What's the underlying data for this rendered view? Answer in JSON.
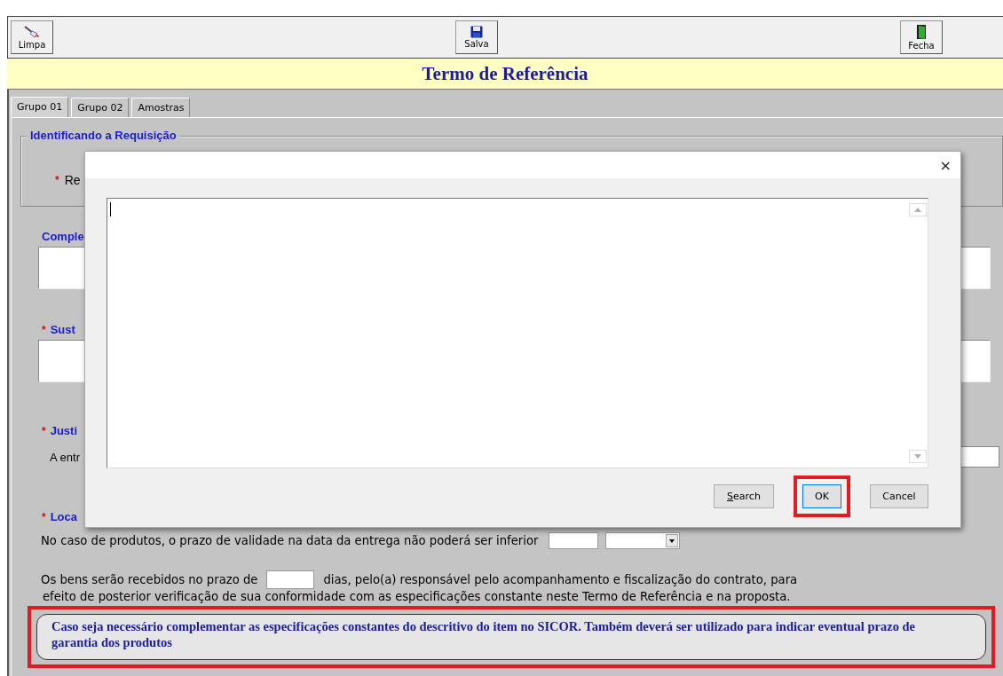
{
  "toolbar": {
    "buttons": [
      {
        "label": "Limpa"
      },
      {
        "label": "Salva"
      },
      {
        "label": "Fecha"
      }
    ]
  },
  "title": "Termo de Referência",
  "tabs": [
    {
      "label": "Grupo 01",
      "selected": true
    },
    {
      "label": "Grupo 02",
      "selected": false
    },
    {
      "label": "Amostras",
      "selected": false
    }
  ],
  "form": {
    "group_title": "Identificando a Requisição",
    "group_fields": [
      {
        "marker": "*",
        "label": "Re"
      }
    ],
    "sections": [
      {
        "label": "Comple",
        "kind": "textarea"
      },
      {
        "marker": "*",
        "label": "Sust",
        "kind": "textarea"
      },
      {
        "marker": "*",
        "label": "Justi",
        "kind": "line",
        "line_text": "A entr"
      },
      {
        "marker": "*",
        "label": "Loca",
        "kind": "plain"
      }
    ],
    "validity": {
      "text": "No caso de produtos, o prazo de validade na data da entrega não poderá ser inferior"
    },
    "receipt": {
      "before": "Os bens serão recebidos no prazo de",
      "after": "dias, pelo(a) responsável pelo acompanhamento e fiscalização do contrato, para",
      "line2": "efeito de posterior verificação de sua conformidade com as especificações constante neste Termo de Referência e na proposta."
    },
    "note": {
      "text": "Caso seja necessário complementar as especificações constantes do descritivo do item no SICOR. Também deverá ser utilizado para indicar eventual prazo de garantia dos produtos",
      "highlighted": true
    }
  },
  "dialog": {
    "close": "×",
    "buttons": [
      {
        "label": "Search",
        "underline_first": true,
        "highlighted": false
      },
      {
        "label": "OK",
        "underline_first": false,
        "highlighted": true
      },
      {
        "label": "Cancel",
        "underline_first": false,
        "highlighted": false
      }
    ]
  }
}
